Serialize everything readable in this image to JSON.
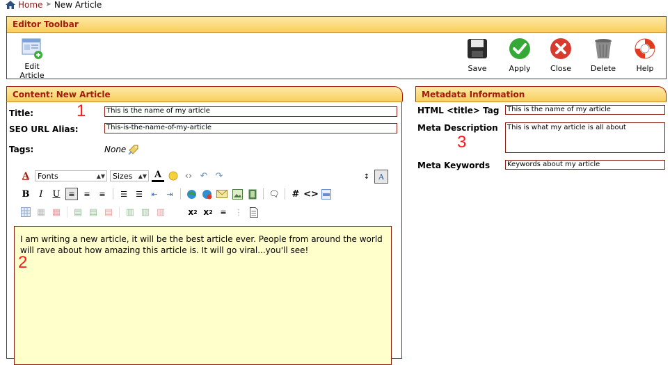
{
  "breadcrumb": {
    "home": "Home",
    "current": "New Article"
  },
  "editor_toolbar": {
    "title": "Editor Toolbar",
    "edit_article": "Edit Article",
    "buttons": {
      "save": "Save",
      "apply": "Apply",
      "close": "Close",
      "delete": "Delete",
      "help": "Help"
    }
  },
  "content": {
    "title": "Content: New Article",
    "title_label": "Title:",
    "title_value": "This is the name of my article",
    "seo_label": "SEO URL Alias:",
    "seo_value": "This-is-the-name-of-my-article",
    "tags_label": "Tags:",
    "tags_value": "None",
    "fonts_select": "Fonts",
    "sizes_select": "Sizes",
    "body_text": "I am writing a new article, it will be the best article ever.  People from around the world will rave about how amazing this article is.  It will go viral...you'll see!"
  },
  "metadata": {
    "title": "Metadata Information",
    "html_title_label": "HTML <title> Tag",
    "html_title_value": "This is the name of my article",
    "meta_desc_label": "Meta Description",
    "meta_desc_value": "This is what my article is all about",
    "meta_keywords_label": "Meta Keywords",
    "meta_keywords_value": "Keywords about my article"
  },
  "annotations": {
    "one": "1",
    "two": "2",
    "three": "3"
  },
  "colors": {
    "accent": "#a31b0c",
    "header_bg": "#f8cf5e",
    "editor_bg": "#ffffcc",
    "annotation": "#ff1a1a"
  },
  "icons": [
    "home-icon",
    "edit-article-icon",
    "save-icon",
    "apply-icon",
    "close-icon",
    "delete-icon",
    "help-icon",
    "tag-icon"
  ]
}
